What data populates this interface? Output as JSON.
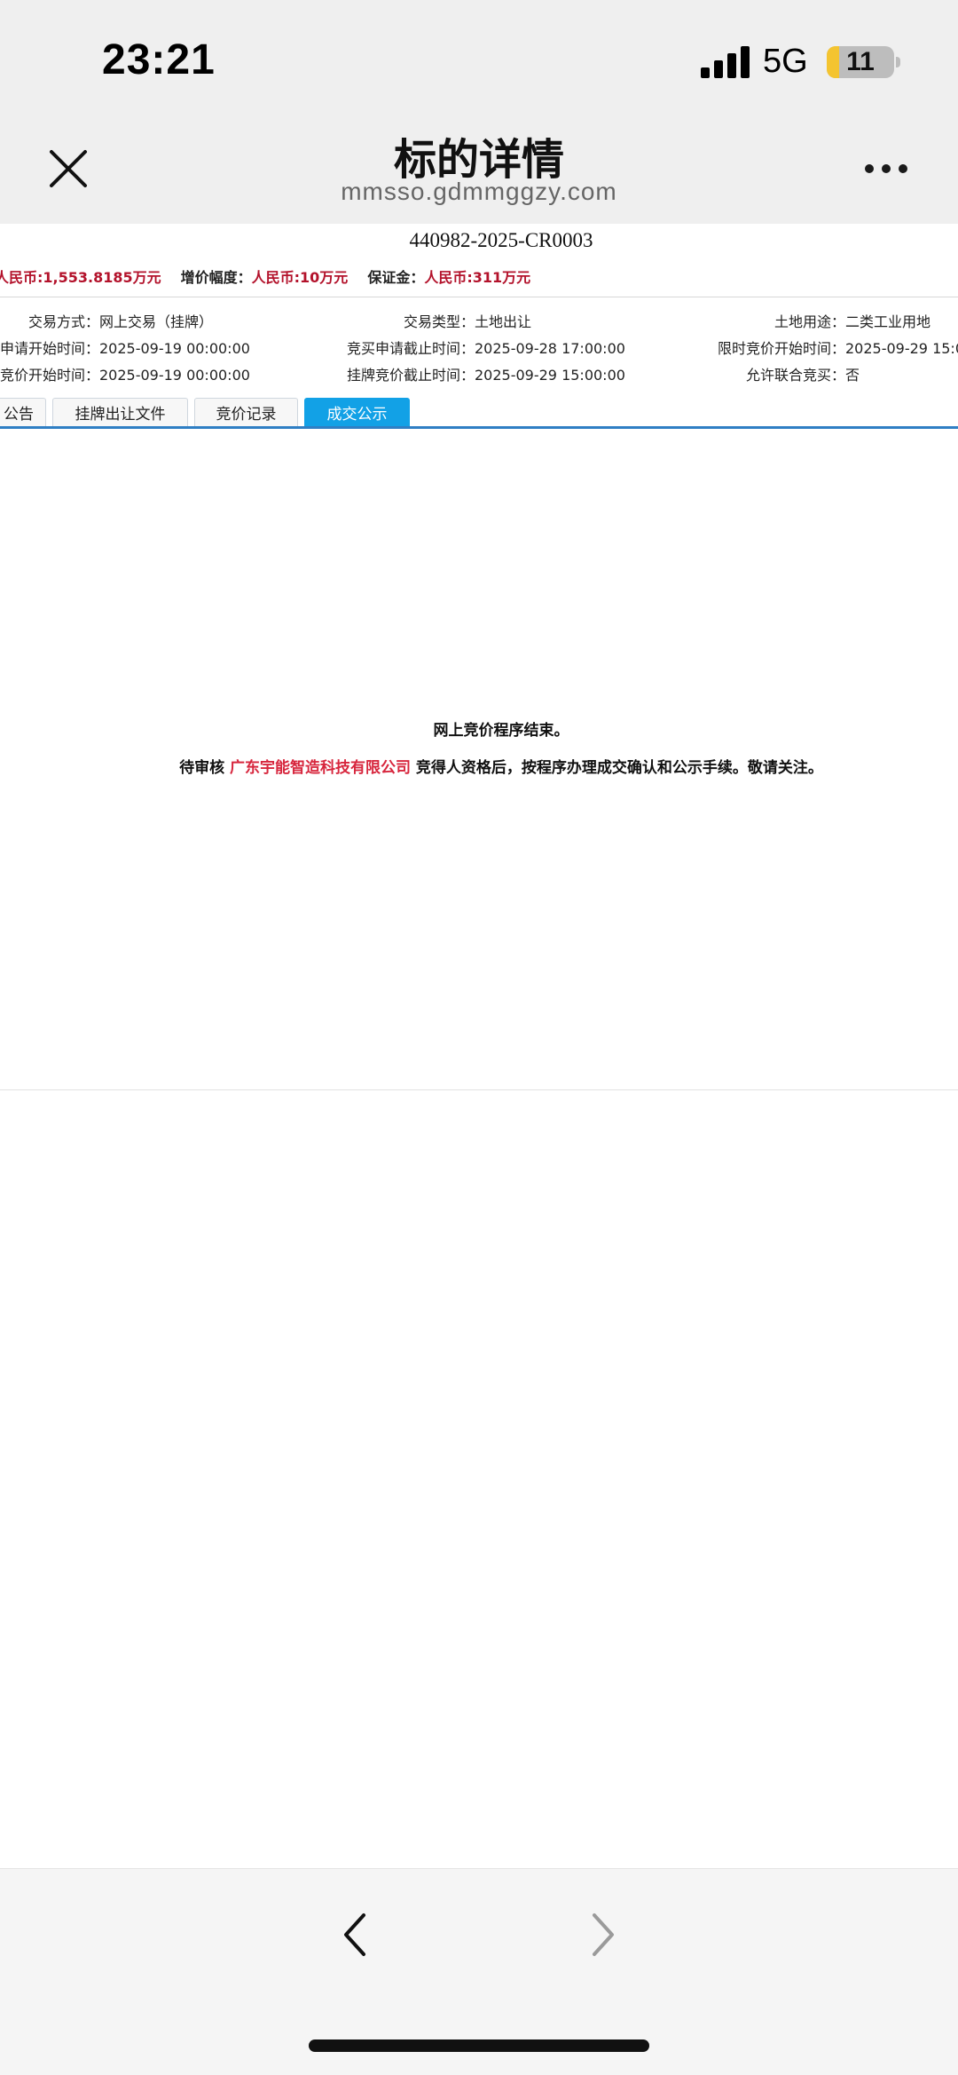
{
  "status_bar": {
    "time": "23:21",
    "network": "5G",
    "battery": "11",
    "battery_level_percent": 11
  },
  "header": {
    "title": "标的详情",
    "url": "mmsso.gdmmggzy.com",
    "close_icon": "close-icon",
    "more_icon": "more-icon"
  },
  "listing": {
    "code": "440982-2025-CR0003",
    "start_price_value": "人民币:1,553.8185万元",
    "increment_label": "增价幅度：",
    "increment_value": "人民币:10万元",
    "deposit_label": "保证金：",
    "deposit_value": "人民币:311万元",
    "rows": [
      [
        {
          "label": "交易方式：",
          "value": "网上交易（挂牌）"
        },
        {
          "label": "交易类型：",
          "value": "土地出让"
        },
        {
          "label": "土地用途：",
          "value": "二类工业用地"
        }
      ],
      [
        {
          "label": "申请开始时间：",
          "value": "2025-09-19 00:00:00"
        },
        {
          "label": "竞买申请截止时间：",
          "value": "2025-09-28 17:00:00"
        },
        {
          "label": "限时竞价开始时间：",
          "value": "2025-09-29 15:0"
        }
      ],
      [
        {
          "label": "竞价开始时间：",
          "value": "2025-09-19 00:00:00"
        },
        {
          "label": "挂牌竞价截止时间：",
          "value": "2025-09-29 15:00:00"
        },
        {
          "label": "允许联合竞买：",
          "value": "否"
        }
      ]
    ]
  },
  "tabs": [
    {
      "label": "公告",
      "active": false
    },
    {
      "label": "挂牌出让文件",
      "active": false
    },
    {
      "label": "竞价记录",
      "active": false
    },
    {
      "label": "成交公示",
      "active": true
    }
  ],
  "result": {
    "title": "网上竞价程序结束。",
    "prefix": "待审核 ",
    "company": "广东宇能智造科技有限公司",
    "suffix": " 竞得人资格后，按程序办理成交确认和公示手续。敬请关注。"
  },
  "bottom_bar": {
    "back_icon": "chevron-left-icon",
    "forward_icon": "chevron-right-icon"
  },
  "colors": {
    "accent_tab": "#12a1e6",
    "tab_underline": "#2f7fc4",
    "price_red": "#b3122b",
    "company_red": "#d7263d",
    "battery_yellow": "#f4c430"
  }
}
